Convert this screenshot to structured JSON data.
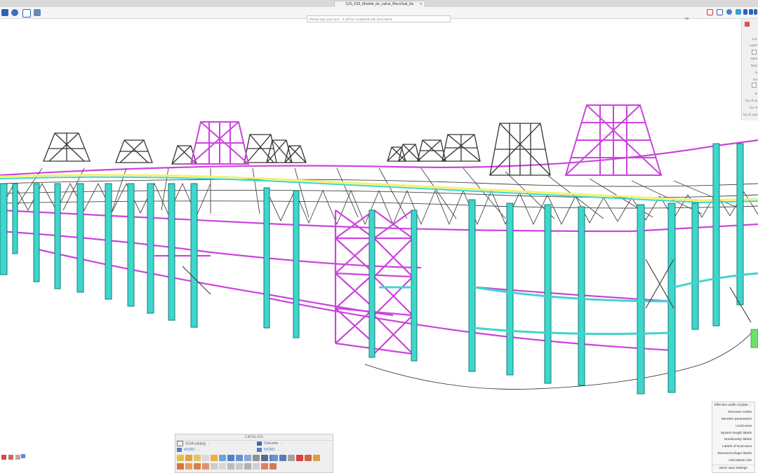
{
  "window": {
    "title": "SJS_K35_Modele_de_calcul_BlocsSud_bis"
  },
  "command_line": {
    "placeholder": "Please type your text... It will be completed with lines below"
  },
  "status": {
    "lang": "en"
  },
  "catalog": {
    "title": "CATALOG",
    "left_catalog": "SCIA catalog",
    "left_filter": "WORD",
    "right_material": "Concrete",
    "right_filter": "WORD"
  },
  "context_menu": {
    "items": [
      "Effective width of plate ...",
      "Structure nodes",
      "Member parameters",
      "Local axes",
      "System length labels",
      "Nonlinearity labels",
      "Labels of local axes",
      "Structural shape labels",
      "Calculation info"
    ],
    "more": "More view settings"
  },
  "colors": {
    "column": "#3fd6cc",
    "column_edge": "#1a7a76",
    "brace": "#cc44dd",
    "truss": "#333333",
    "beam": "#f4f070",
    "background": "#ffffff"
  },
  "icons": {
    "toolbar": [
      "save-icon",
      "open-icon",
      "library-icon",
      "settings-icon"
    ],
    "right_toolbar": [
      "red-square-icon",
      "copy-icon",
      "user-icon",
      "tree-icon",
      "link-icon",
      "cloud-icon",
      "help-icon"
    ]
  }
}
